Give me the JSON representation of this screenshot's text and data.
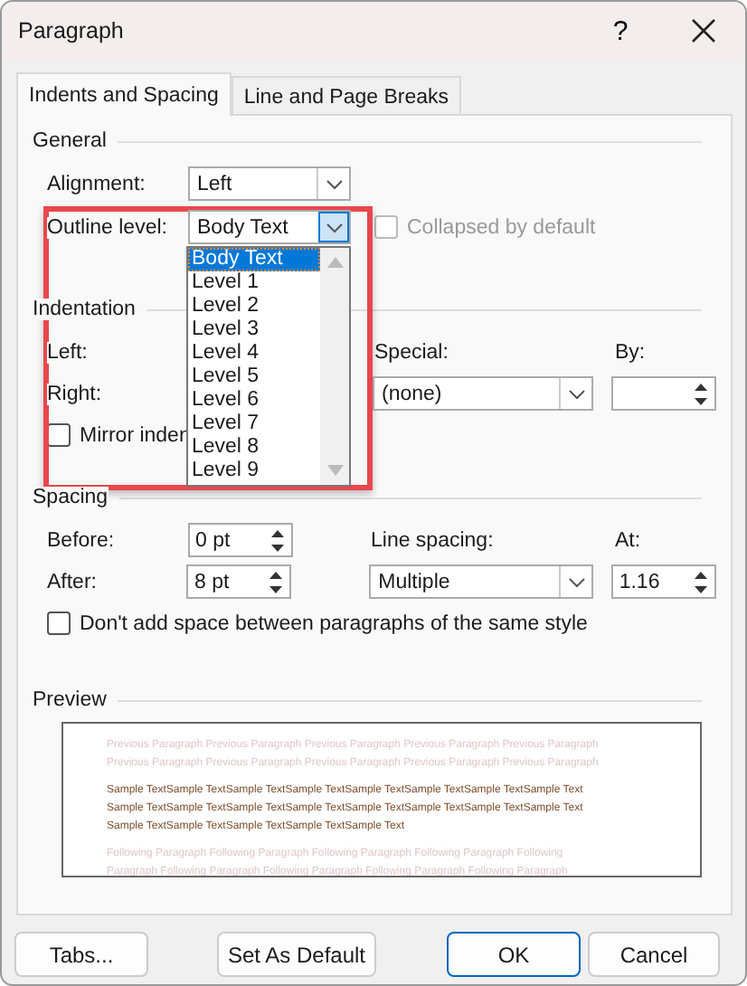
{
  "window": {
    "title": "Paragraph",
    "help": "?"
  },
  "tabs": [
    {
      "label": "Indents and Spacing",
      "selected": true
    },
    {
      "label": "Line and Page Breaks",
      "selected": false
    }
  ],
  "general": {
    "heading": "General",
    "alignment": {
      "label": "Alignment:",
      "value": "Left"
    },
    "outline_level": {
      "label": "Outline level:",
      "value": "Body Text",
      "expanded": true,
      "options": [
        {
          "label": "Body Text",
          "selected": true
        },
        {
          "label": "Level 1",
          "selected": false
        },
        {
          "label": "Level 2",
          "selected": false
        },
        {
          "label": "Level 3",
          "selected": false
        },
        {
          "label": "Level 4",
          "selected": false
        },
        {
          "label": "Level 5",
          "selected": false
        },
        {
          "label": "Level 6",
          "selected": false
        },
        {
          "label": "Level 7",
          "selected": false
        },
        {
          "label": "Level 8",
          "selected": false
        },
        {
          "label": "Level 9",
          "selected": false
        }
      ]
    },
    "collapsed_by_default": {
      "label": "Collapsed by default",
      "checked": false,
      "disabled": true
    }
  },
  "indentation": {
    "heading": "Indentation",
    "left_label": "Left:",
    "right_label": "Right:",
    "special": {
      "label": "Special:",
      "value": "(none)"
    },
    "by": {
      "label": "By:"
    },
    "mirror_indents": {
      "label": "Mirror inden",
      "checked": false
    }
  },
  "spacing": {
    "heading": "Spacing",
    "before": {
      "label": "Before:",
      "value": "0 pt"
    },
    "after": {
      "label": "After:",
      "value": "8 pt"
    },
    "line_spacing": {
      "label": "Line spacing:",
      "value": "Multiple"
    },
    "at": {
      "label": "At:",
      "value": "1.16"
    },
    "no_space_same_style": {
      "label": "Don't add space between paragraphs of the same style",
      "checked": false
    }
  },
  "preview": {
    "heading": "Preview",
    "previous_lines": [
      "Previous Paragraph Previous Paragraph Previous Paragraph Previous Paragraph Previous Paragraph",
      "Previous Paragraph Previous Paragraph Previous Paragraph Previous Paragraph Previous Paragraph"
    ],
    "sample_lines": [
      "Sample TextSample TextSample TextSample TextSample TextSample TextSample TextSample Text",
      "Sample TextSample TextSample TextSample TextSample TextSample TextSample TextSample Text",
      "Sample TextSample TextSample TextSample TextSample Text"
    ],
    "following_lines": [
      "Following Paragraph Following Paragraph Following Paragraph Following Paragraph Following",
      "Paragraph Following Paragraph Following Paragraph Following Paragraph Following Paragraph"
    ]
  },
  "buttons": [
    {
      "label": "Tabs...",
      "default": false
    },
    {
      "label": "Set As Default",
      "default": false
    },
    {
      "label": "OK",
      "default": true
    },
    {
      "label": "Cancel",
      "default": false
    }
  ]
}
